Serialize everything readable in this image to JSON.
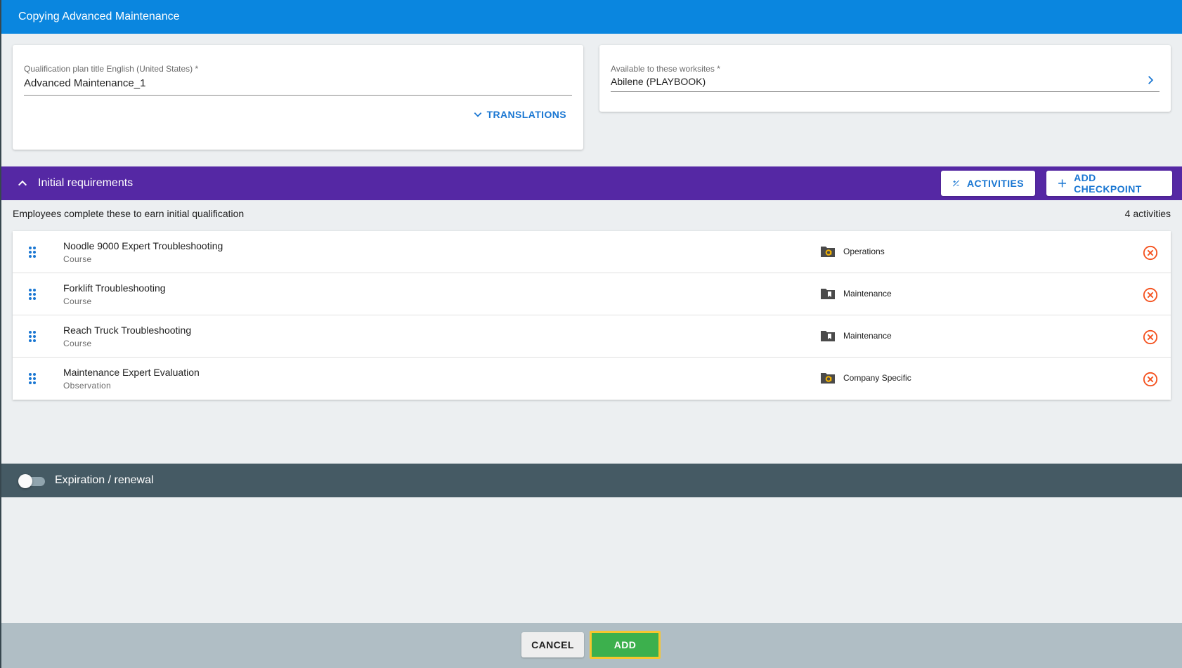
{
  "header": {
    "title": "Copying Advanced Maintenance"
  },
  "title_card": {
    "label": "Qualification plan title English (United States) *",
    "value": "Advanced Maintenance_1",
    "translations_label": "TRANSLATIONS"
  },
  "worksite_card": {
    "label": "Available to these worksites *",
    "value": "Abilene (PLAYBOOK)"
  },
  "initial_requirements": {
    "title": "Initial requirements",
    "activities_button": "ACTIVITIES",
    "add_checkpoint_button": "ADD CHECKPOINT",
    "description": "Employees complete these to earn initial qualification",
    "count": "4 activities",
    "items": [
      {
        "title": "Noodle 9000 Expert Troubleshooting",
        "type": "Course",
        "category": "Operations",
        "icon": "company-folder-icon"
      },
      {
        "title": "Forklift Troubleshooting",
        "type": "Course",
        "category": "Maintenance",
        "icon": "bookmark-folder-icon"
      },
      {
        "title": "Reach Truck Troubleshooting",
        "type": "Course",
        "category": "Maintenance",
        "icon": "bookmark-folder-icon"
      },
      {
        "title": "Maintenance Expert Evaluation",
        "type": "Observation",
        "category": "Company Specific",
        "icon": "company-folder-icon"
      }
    ]
  },
  "expiration": {
    "title": "Expiration / renewal",
    "enabled": false
  },
  "footer": {
    "cancel_label": "CANCEL",
    "add_label": "ADD"
  },
  "colors": {
    "header": "#0a86df",
    "section_bar": "#5528a4",
    "expiration_bar": "#455a64",
    "footer": "#b0bec5",
    "add_button": "#3cb04d",
    "add_button_focus": "#f7c62f",
    "remove_icon": "#f4511e",
    "accent": "#1976d2"
  }
}
